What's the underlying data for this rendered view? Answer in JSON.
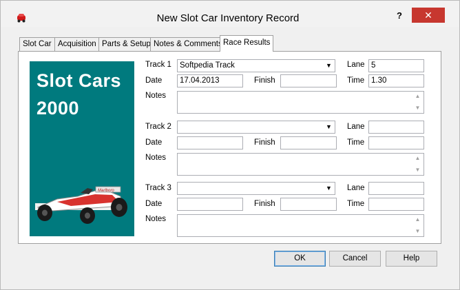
{
  "window": {
    "title": "New Slot Car Inventory Record",
    "help_glyph": "?",
    "close_glyph": "✕",
    "app_icon": "red-car-icon"
  },
  "tabs": [
    {
      "label": "Slot Car",
      "active": false
    },
    {
      "label": "Acquisition",
      "active": false
    },
    {
      "label": "Parts & Setup",
      "active": false
    },
    {
      "label": "Notes & Comments",
      "active": false
    },
    {
      "label": "Race Results",
      "active": true
    }
  ],
  "logo": {
    "line1": "Slot Cars",
    "line2": "2000",
    "bg_color": "#007a7e",
    "car_decal": "Marlboro"
  },
  "labels": {
    "date": "Date",
    "finish": "Finish",
    "notes": "Notes",
    "lane": "Lane",
    "time": "Time"
  },
  "tracks": [
    {
      "label": "Track 1",
      "track": "Softpedia Track",
      "lane": "5",
      "date": "17.04.2013",
      "finish": "",
      "time": "1.30",
      "notes": ""
    },
    {
      "label": "Track 2",
      "track": "",
      "lane": "",
      "date": "",
      "finish": "",
      "time": "",
      "notes": ""
    },
    {
      "label": "Track 3",
      "track": "",
      "lane": "",
      "date": "",
      "finish": "",
      "time": "",
      "notes": ""
    }
  ],
  "buttons": {
    "ok": "OK",
    "cancel": "Cancel",
    "help": "Help"
  },
  "colors": {
    "close_button": "#c7372f",
    "logo_background": "#007a7e"
  }
}
